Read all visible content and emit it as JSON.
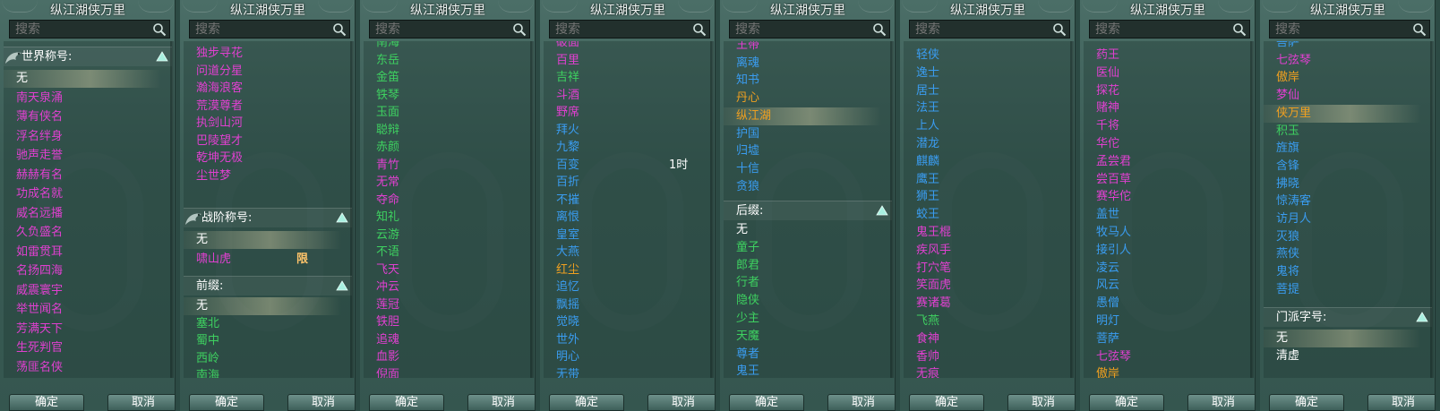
{
  "colors": {
    "magenta": "#e040d0",
    "green": "#3ed060",
    "blue": "#3a9cf0",
    "white": "#ffffff",
    "orange": "#f0a020"
  },
  "panels": [
    {
      "title": "纵江湖侠万里",
      "search_placeholder": "搜索",
      "ok": "确定",
      "cancel": "取消",
      "sections": [
        {
          "label": "世界称号:",
          "top": 0,
          "dragon": true
        },
        {
          "label": "",
          "top": -1
        }
      ],
      "items": [
        {
          "text": "无",
          "color": "white",
          "sel": true
        },
        {
          "text": "南天泉涌",
          "color": "magenta"
        },
        {
          "text": "薄有侠名",
          "color": "magenta"
        },
        {
          "text": "浮名绊身",
          "color": "magenta"
        },
        {
          "text": "驰声走誉",
          "color": "magenta"
        },
        {
          "text": "赫赫有名",
          "color": "magenta"
        },
        {
          "text": "功成名就",
          "color": "magenta"
        },
        {
          "text": "威名远播",
          "color": "magenta"
        },
        {
          "text": "久负盛名",
          "color": "magenta"
        },
        {
          "text": "如雷贯耳",
          "color": "magenta"
        },
        {
          "text": "名扬四海",
          "color": "magenta"
        },
        {
          "text": "威震寰宇",
          "color": "magenta"
        },
        {
          "text": "举世闻名",
          "color": "magenta"
        },
        {
          "text": "芳满天下",
          "color": "magenta"
        },
        {
          "text": "生死判官",
          "color": "magenta"
        },
        {
          "text": "荡匪名侠",
          "color": "magenta"
        }
      ]
    },
    {
      "title": "纵江湖侠万里",
      "search_placeholder": "搜索",
      "ok": "确定",
      "cancel": "取消",
      "items_top": [
        {
          "text": "独步寻花",
          "color": "magenta"
        },
        {
          "text": "问道分星",
          "color": "magenta"
        },
        {
          "text": "瀚海浪客",
          "color": "magenta"
        },
        {
          "text": "荒漠尊者",
          "color": "magenta"
        },
        {
          "text": "执剑山河",
          "color": "magenta"
        },
        {
          "text": "巴陵望才",
          "color": "magenta"
        },
        {
          "text": "乾坤无极",
          "color": "magenta"
        },
        {
          "text": "尘世梦",
          "color": "magenta"
        }
      ],
      "section2": {
        "label": "战阶称号:"
      },
      "items_mid": [
        {
          "text": "无",
          "color": "white",
          "sel": true
        },
        {
          "text": "啸山虎",
          "color": "magenta",
          "badge": "限"
        }
      ],
      "section3": {
        "label": "前缀:"
      },
      "items_bottom": [
        {
          "text": "无",
          "color": "white",
          "sel": true
        },
        {
          "text": "塞北",
          "color": "green"
        },
        {
          "text": "蜀中",
          "color": "green"
        },
        {
          "text": "西岭",
          "color": "green"
        },
        {
          "text": "南海",
          "color": "green"
        }
      ]
    },
    {
      "title": "纵江湖侠万里",
      "search_placeholder": "搜索",
      "ok": "确定",
      "cancel": "取消",
      "items": [
        {
          "text": "南海",
          "color": "green"
        },
        {
          "text": "东岳",
          "color": "green"
        },
        {
          "text": "金笛",
          "color": "green"
        },
        {
          "text": "铁琴",
          "color": "green"
        },
        {
          "text": "玉面",
          "color": "green"
        },
        {
          "text": "聪辩",
          "color": "green"
        },
        {
          "text": "赤颜",
          "color": "green"
        },
        {
          "text": "青竹",
          "color": "magenta"
        },
        {
          "text": "无常",
          "color": "magenta"
        },
        {
          "text": "夺命",
          "color": "magenta"
        },
        {
          "text": "知礼",
          "color": "green"
        },
        {
          "text": "云游",
          "color": "green"
        },
        {
          "text": "不语",
          "color": "green"
        },
        {
          "text": "飞天",
          "color": "magenta"
        },
        {
          "text": "冲云",
          "color": "magenta"
        },
        {
          "text": "莲冠",
          "color": "magenta"
        },
        {
          "text": "铁胆",
          "color": "magenta"
        },
        {
          "text": "追魂",
          "color": "magenta"
        },
        {
          "text": "血影",
          "color": "magenta"
        },
        {
          "text": "倪面",
          "color": "magenta"
        }
      ]
    },
    {
      "title": "纵江湖侠万里",
      "search_placeholder": "搜索",
      "ok": "确定",
      "cancel": "取消",
      "side_note": "1时",
      "items": [
        {
          "text": "破面",
          "color": "magenta"
        },
        {
          "text": "百里",
          "color": "magenta"
        },
        {
          "text": "吉祥",
          "color": "green"
        },
        {
          "text": "斗酒",
          "color": "magenta"
        },
        {
          "text": "野席",
          "color": "magenta"
        },
        {
          "text": "拜火",
          "color": "blue"
        },
        {
          "text": "九黎",
          "color": "blue"
        },
        {
          "text": "百变",
          "color": "blue"
        },
        {
          "text": "百折",
          "color": "blue"
        },
        {
          "text": "不摧",
          "color": "blue"
        },
        {
          "text": "离恨",
          "color": "blue"
        },
        {
          "text": "皇室",
          "color": "blue"
        },
        {
          "text": "大燕",
          "color": "blue"
        },
        {
          "text": "红尘",
          "color": "orange"
        },
        {
          "text": "追忆",
          "color": "blue"
        },
        {
          "text": "飘摇",
          "color": "blue"
        },
        {
          "text": "觉晓",
          "color": "blue"
        },
        {
          "text": "世外",
          "color": "blue"
        },
        {
          "text": "明心",
          "color": "blue"
        },
        {
          "text": "无带",
          "color": "blue"
        }
      ]
    },
    {
      "title": "纵江湖侠万里",
      "search_placeholder": "搜索",
      "ok": "确定",
      "cancel": "取消",
      "items_top": [
        {
          "text": "王带",
          "color": "magenta"
        },
        {
          "text": "离魂",
          "color": "blue"
        },
        {
          "text": "知书",
          "color": "blue"
        },
        {
          "text": "丹心",
          "color": "orange"
        },
        {
          "text": "纵江湖",
          "color": "orange",
          "sel": true
        },
        {
          "text": "护国",
          "color": "blue"
        },
        {
          "text": "归墟",
          "color": "blue"
        },
        {
          "text": "十信",
          "color": "blue"
        },
        {
          "text": "贪狼",
          "color": "blue"
        }
      ],
      "section2": {
        "label": "后缀:"
      },
      "items_bottom": [
        {
          "text": "无",
          "color": "white"
        },
        {
          "text": "童子",
          "color": "green"
        },
        {
          "text": "郎君",
          "color": "green"
        },
        {
          "text": "行者",
          "color": "green"
        },
        {
          "text": "隐侠",
          "color": "green"
        },
        {
          "text": "少主",
          "color": "green"
        },
        {
          "text": "天魔",
          "color": "green"
        },
        {
          "text": "尊者",
          "color": "blue"
        },
        {
          "text": "鬼王",
          "color": "blue"
        }
      ]
    },
    {
      "title": "纵江湖侠万里",
      "search_placeholder": "搜索",
      "ok": "确定",
      "cancel": "取消",
      "items": [
        {
          "text": "轻侠",
          "color": "blue"
        },
        {
          "text": "逸士",
          "color": "blue"
        },
        {
          "text": "居士",
          "color": "blue"
        },
        {
          "text": "法王",
          "color": "blue"
        },
        {
          "text": "上人",
          "color": "blue"
        },
        {
          "text": "潜龙",
          "color": "blue"
        },
        {
          "text": "麒麟",
          "color": "blue"
        },
        {
          "text": "鹰王",
          "color": "blue"
        },
        {
          "text": "狮王",
          "color": "blue"
        },
        {
          "text": "蛟王",
          "color": "blue"
        },
        {
          "text": "鬼王棍",
          "color": "magenta"
        },
        {
          "text": "疾风手",
          "color": "magenta"
        },
        {
          "text": "打穴笔",
          "color": "magenta"
        },
        {
          "text": "笑面虎",
          "color": "magenta"
        },
        {
          "text": "赛诸葛",
          "color": "magenta"
        },
        {
          "text": "飞燕",
          "color": "green"
        },
        {
          "text": "食神",
          "color": "magenta"
        },
        {
          "text": "香帅",
          "color": "magenta"
        },
        {
          "text": "无痕",
          "color": "magenta"
        }
      ]
    },
    {
      "title": "纵江湖侠万里",
      "search_placeholder": "搜索",
      "ok": "确定",
      "cancel": "取消",
      "items": [
        {
          "text": "药王",
          "color": "magenta"
        },
        {
          "text": "医仙",
          "color": "magenta"
        },
        {
          "text": "探花",
          "color": "magenta"
        },
        {
          "text": "赌神",
          "color": "magenta"
        },
        {
          "text": "千将",
          "color": "magenta"
        },
        {
          "text": "华佗",
          "color": "magenta"
        },
        {
          "text": "孟尝君",
          "color": "magenta"
        },
        {
          "text": "尝百草",
          "color": "magenta"
        },
        {
          "text": "赛华佗",
          "color": "magenta"
        },
        {
          "text": "盖世",
          "color": "blue"
        },
        {
          "text": "牧马人",
          "color": "blue"
        },
        {
          "text": "接引人",
          "color": "blue"
        },
        {
          "text": "凌云",
          "color": "blue"
        },
        {
          "text": "风云",
          "color": "blue"
        },
        {
          "text": "愚僧",
          "color": "blue"
        },
        {
          "text": "明灯",
          "color": "blue"
        },
        {
          "text": "菩萨",
          "color": "blue"
        },
        {
          "text": "七弦琴",
          "color": "magenta"
        },
        {
          "text": "傲岸",
          "color": "orange"
        }
      ]
    },
    {
      "title": "纵江湖侠万里",
      "search_placeholder": "搜索",
      "ok": "确定",
      "cancel": "取消",
      "items_top": [
        {
          "text": "菩萨",
          "color": "blue"
        },
        {
          "text": "七弦琴",
          "color": "magenta"
        },
        {
          "text": "傲岸",
          "color": "orange"
        },
        {
          "text": "梦仙",
          "color": "magenta"
        },
        {
          "text": "侠万里",
          "color": "orange",
          "sel": true
        },
        {
          "text": "积玉",
          "color": "green"
        },
        {
          "text": "旌旗",
          "color": "blue"
        },
        {
          "text": "含锋",
          "color": "blue"
        },
        {
          "text": "拂晓",
          "color": "blue"
        },
        {
          "text": "惊涛客",
          "color": "blue"
        },
        {
          "text": "访月人",
          "color": "blue"
        },
        {
          "text": "灭狼",
          "color": "blue"
        },
        {
          "text": "燕侠",
          "color": "blue"
        },
        {
          "text": "鬼将",
          "color": "blue"
        },
        {
          "text": "菩提",
          "color": "blue"
        }
      ],
      "section2": {
        "label": "门派字号:"
      },
      "items_bottom": [
        {
          "text": "无",
          "color": "white",
          "sel": true
        },
        {
          "text": "清虚",
          "color": "white"
        }
      ]
    }
  ]
}
